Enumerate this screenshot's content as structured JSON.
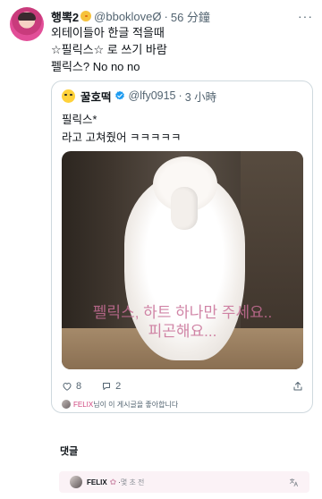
{
  "post": {
    "display_name": "행뽁2",
    "handle": "@bbokloveØ",
    "separator": "·",
    "time": "56 分鐘",
    "text_lines": [
      "외테이들아 한글 적을때",
      "☆필릭스☆ 로 쓰기 바람",
      "펠릭스? No no no"
    ]
  },
  "quote": {
    "display_name": "꿀호떡",
    "handle": "@lfy0915",
    "separator": "·",
    "time": "3 小時",
    "text_lines": [
      "필릭스*",
      "라고 고쳐줬어 ㅋㅋㅋㅋㅋ"
    ],
    "image_caption_lines": [
      "펠릭스, 하트 하나만 주세요..",
      "피곤해요..."
    ],
    "like_count": "8",
    "reply_count": "2"
  },
  "liked_by": {
    "name": "FELIX",
    "text": "님이 이 게시글을 좋아합니다"
  },
  "comments": {
    "label": "댓글",
    "reply_name": "FELIX",
    "reply_time": "몇 초 전"
  },
  "colors": {
    "accent_pink": "#d0467f",
    "verified_blue": "#1d9bf0",
    "muted": "#536471"
  },
  "icons": {
    "more": "more-icon",
    "verified": "verified-icon",
    "like": "heart-icon",
    "reply": "reply-icon",
    "share": "share-icon",
    "translate": "translate-icon"
  }
}
